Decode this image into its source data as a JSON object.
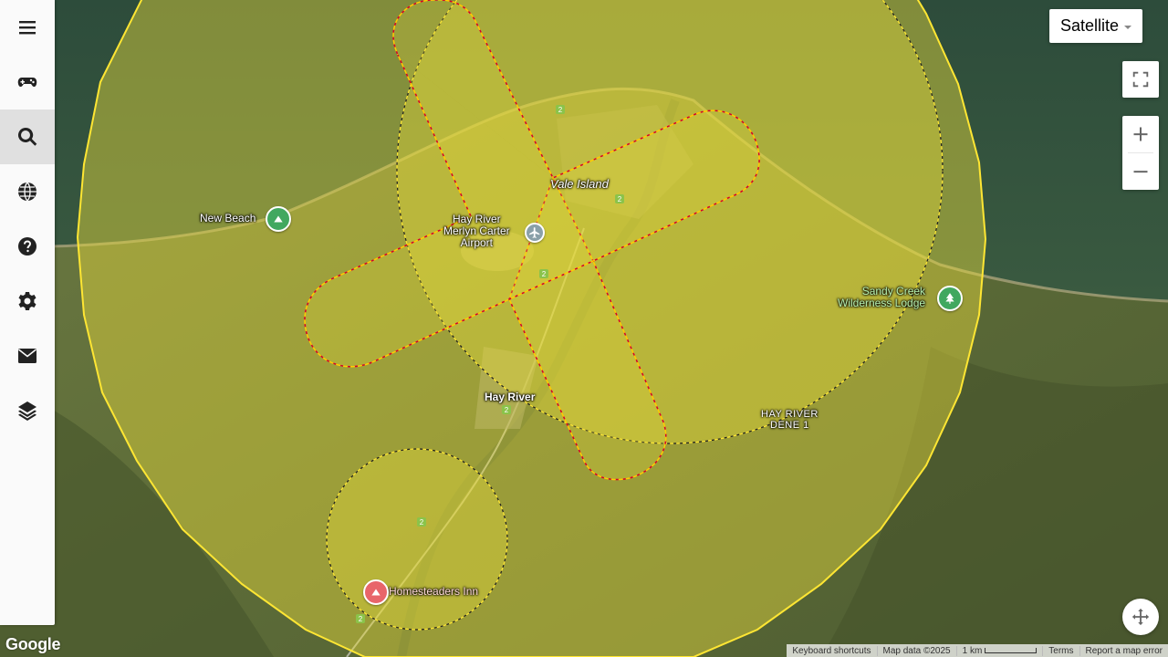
{
  "map": {
    "type_control_label": "Satellite",
    "places": {
      "new_beach": "New Beach",
      "vale_island": "Vale Island",
      "airport_line1": "Hay River",
      "airport_line2": "Merlyn Carter",
      "airport_line3": "Airport",
      "hay_river": "Hay River",
      "sandy_creek_line1": "Sandy Creek",
      "sandy_creek_line2": "Wilderness Lodge",
      "dene_line1": "HAY RIVER",
      "dene_line2": "DENE 1",
      "homesteaders": "Homesteaders Inn"
    },
    "route_shield": "2",
    "colors": {
      "zone_fill": "#e8dc3c",
      "zone_stroke": "#ffe633",
      "runway_stroke": "#d4002a"
    }
  },
  "sidebar": {
    "items": [
      {
        "icon": "menu-icon"
      },
      {
        "icon": "gamepad-icon"
      },
      {
        "icon": "search-icon"
      },
      {
        "icon": "globe-icon"
      },
      {
        "icon": "help-icon"
      },
      {
        "icon": "gear-icon"
      },
      {
        "icon": "mail-icon"
      },
      {
        "icon": "layers-icon"
      }
    ]
  },
  "footer": {
    "logo": "Google",
    "shortcuts": "Keyboard shortcuts",
    "map_data": "Map data ©2025",
    "scale": "1 km",
    "terms": "Terms",
    "report": "Report a map error"
  }
}
